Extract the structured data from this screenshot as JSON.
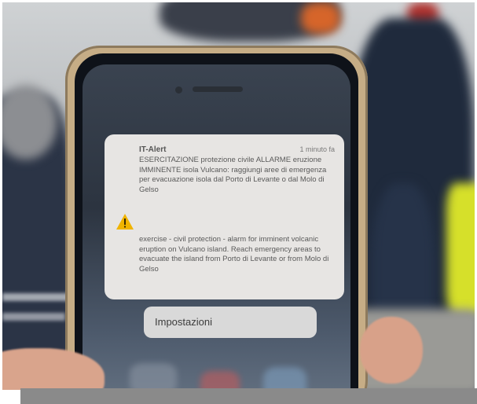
{
  "photo": {
    "description_icons": [
      "warning-icon"
    ]
  },
  "alert": {
    "app_name": "IT-Alert",
    "time": "1 minuto fa",
    "text_it": "ESERCITAZIONE protezione civile ALLARME eruzione IMMINENTE isola Vulcano: raggiungi aree di emergenza per evacuazione isola dal Porto di Levante o dal Molo di Gelso",
    "text_en": "exercise - civil protection - alarm for imminent volcanic eruption on Vulcano island. Reach emergency areas to evacuate the island from Porto di Levante or from Molo di Gelso"
  },
  "settings_button": {
    "label": "Impostazioni"
  },
  "colors": {
    "card_bg": "#e7e5e3",
    "phone_case": "#c6ad86",
    "warning_yellow": "#f0b400"
  }
}
